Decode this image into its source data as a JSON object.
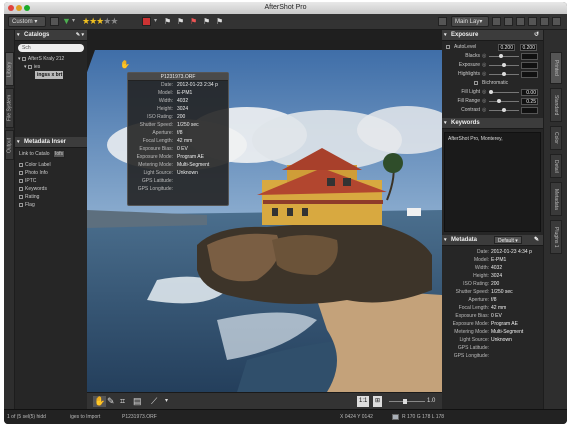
{
  "window": {
    "title": "AfterShot Pro"
  },
  "toolbar": {
    "workspace": "Custom",
    "layout": "Main Lay▾",
    "colors": {
      "stars": "#f0c020",
      "flag_red": "#c33",
      "filter": "#4caf50",
      "color_label": "#d04040"
    }
  },
  "left_tabs": [
    "Library",
    "File System",
    "Output"
  ],
  "catalogs": {
    "header": "Catalogs",
    "search_placeholder": "Sch",
    "tree": [
      {
        "label": "AfterS Kraly 212",
        "level": 0
      },
      {
        "label": "ies",
        "level": 1
      },
      {
        "label": "ingss x brt",
        "level": 2,
        "selected": true
      }
    ]
  },
  "metadata_left": {
    "header": "Metadata Inser",
    "link_label": "Link to Catalo",
    "link_btn": "Iofs",
    "items": [
      "Color Label",
      "Photo Info",
      "IPTC",
      "Keywords",
      "Rating",
      "Flag"
    ]
  },
  "info_overlay": {
    "filename": "P1231973.ORF",
    "rows": [
      {
        "k": "Date:",
        "v": "2012-01-23 2:34 p"
      },
      {
        "k": "Model:",
        "v": "E-PM1"
      },
      {
        "k": "Width:",
        "v": "4032"
      },
      {
        "k": "Height:",
        "v": "3024"
      },
      {
        "k": "ISO Rating:",
        "v": "200"
      },
      {
        "k": "Shutter Speed:",
        "v": "1/250 sec"
      },
      {
        "k": "Aperture:",
        "v": "f/8"
      },
      {
        "k": "Focal Length:",
        "v": "42 mm"
      },
      {
        "k": "Exposure Bias:",
        "v": "0 EV"
      },
      {
        "k": "Exposure Mode:",
        "v": "Program AE"
      },
      {
        "k": "Metering Mode:",
        "v": "Multi-Segment"
      },
      {
        "k": "Light Source:",
        "v": "Unknown"
      },
      {
        "k": "GPS Latitude:",
        "v": ""
      },
      {
        "k": "GPS Longitude:",
        "v": ""
      }
    ]
  },
  "exposure": {
    "header": "Exposure",
    "autolevel_label": "AutoLevel",
    "autolevel_vals": [
      "0.200",
      "0.200"
    ],
    "rows": [
      {
        "k": "Blacks",
        "val": "",
        "pos": 0.4
      },
      {
        "k": "Exposure",
        "val": "",
        "pos": 0.5
      },
      {
        "k": "Highlights",
        "val": "",
        "pos": 0.5
      }
    ],
    "bichromatic": "Bichromatic",
    "rows2": [
      {
        "k": "Fill Light",
        "val": "0.00",
        "pos": 0.0
      },
      {
        "k": "Fill Range",
        "val": "0.25",
        "pos": 0.3
      },
      {
        "k": "Contrast",
        "val": "",
        "pos": 0.5
      }
    ]
  },
  "keywords": {
    "header": "Keywords",
    "text": "AfterShot Pro, Monterey,"
  },
  "metadata_right": {
    "header": "Metadata",
    "preset": "Default",
    "rows": [
      {
        "k": "Date:",
        "v": "2012-01-23 4:34 p"
      },
      {
        "k": "Model:",
        "v": "E-PM1"
      },
      {
        "k": "Width:",
        "v": "4032"
      },
      {
        "k": "Height:",
        "v": "3024"
      },
      {
        "k": "ISO Rating:",
        "v": "200"
      },
      {
        "k": "Shutter Speed:",
        "v": "1/250 sec"
      },
      {
        "k": "Aperture:",
        "v": "f/8"
      },
      {
        "k": "Focal Length:",
        "v": "42 mm"
      },
      {
        "k": "Exposure Bias:",
        "v": "0 EV"
      },
      {
        "k": "Exposure Mode:",
        "v": "Program AE"
      },
      {
        "k": "Metering Mode:",
        "v": "Multi-Segment"
      },
      {
        "k": "Light Source:",
        "v": "Unknown"
      },
      {
        "k": "GPS Latitude:",
        "v": ""
      },
      {
        "k": "GPS Longitude:",
        "v": ""
      }
    ]
  },
  "right_tabs": [
    "Printed",
    "Standard",
    "Color",
    "Detail",
    "Metadata",
    "Plugins 1"
  ],
  "bottom_bar": {
    "zoom_fit": "1:1",
    "zoom_value": "1.0"
  },
  "status": {
    "count": "1 of (5 sel(5) hidd",
    "import": "iges to Import",
    "filename": "P1231973.ORF",
    "coords": "X 0424  Y 0142",
    "rgb": "R 170  G 178  L 178"
  }
}
